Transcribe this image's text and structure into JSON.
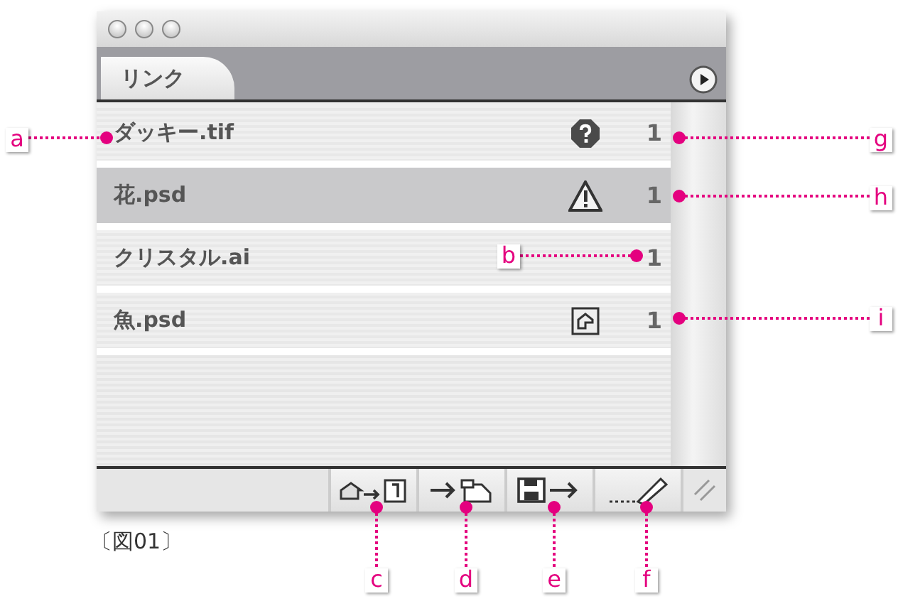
{
  "tabs": [
    {
      "label": "リンク",
      "selected": true
    }
  ],
  "links": [
    {
      "name": "ダッキー.tif",
      "kind": "missing",
      "count": "1",
      "selected": false
    },
    {
      "name": "花.psd",
      "kind": "modified",
      "count": "1",
      "selected": true
    },
    {
      "name": "クリスタル.ai",
      "kind": "ok",
      "count": "1",
      "selected": false
    },
    {
      "name": "魚.psd",
      "kind": "embedded",
      "count": "1",
      "selected": false
    }
  ],
  "caption": "〔図01〕",
  "callouts": [
    {
      "letter": "a"
    },
    {
      "letter": "b"
    },
    {
      "letter": "c"
    },
    {
      "letter": "d"
    },
    {
      "letter": "e"
    },
    {
      "letter": "f"
    },
    {
      "letter": "g"
    },
    {
      "letter": "h"
    },
    {
      "letter": "i"
    }
  ]
}
